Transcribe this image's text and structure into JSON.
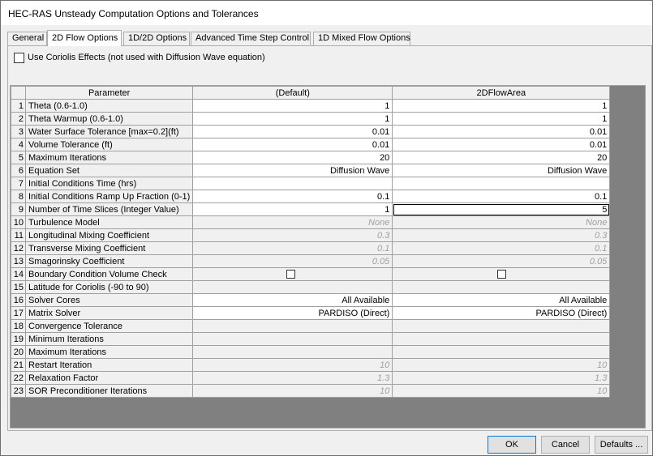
{
  "window": {
    "title": "HEC-RAS Unsteady Computation Options and Tolerances"
  },
  "tabs": [
    {
      "label": "General"
    },
    {
      "label": "2D Flow Options"
    },
    {
      "label": "1D/2D Options"
    },
    {
      "label": "Advanced Time Step Control"
    },
    {
      "label": "1D Mixed Flow Options"
    }
  ],
  "coriolis": {
    "label": "Use Coriolis Effects (not used with Diffusion Wave equation)",
    "checked": false
  },
  "grid": {
    "headers": {
      "parameter": "Parameter",
      "default": "(Default)",
      "area": "2DFlowArea"
    },
    "rows": [
      {
        "n": "1",
        "param": "Theta  (0.6-1.0)",
        "def": "1",
        "area": "1"
      },
      {
        "n": "2",
        "param": "Theta Warmup  (0.6-1.0)",
        "def": "1",
        "area": "1"
      },
      {
        "n": "3",
        "param": "Water Surface Tolerance [max=0.2](ft)",
        "def": "0.01",
        "area": "0.01"
      },
      {
        "n": "4",
        "param": "Volume Tolerance (ft)",
        "def": "0.01",
        "area": "0.01"
      },
      {
        "n": "5",
        "param": "Maximum Iterations",
        "def": "20",
        "area": "20"
      },
      {
        "n": "6",
        "param": "Equation Set",
        "def": "Diffusion Wave",
        "area": "Diffusion Wave"
      },
      {
        "n": "7",
        "param": "Initial Conditions Time (hrs)",
        "def": "",
        "area": ""
      },
      {
        "n": "8",
        "param": "Initial Conditions Ramp Up Fraction (0-1)",
        "def": "0.1",
        "area": "0.1"
      },
      {
        "n": "9",
        "param": "Number of Time Slices (Integer Value)",
        "def": "1",
        "area": "5"
      },
      {
        "n": "10",
        "param": "Turbulence Model",
        "def": "None",
        "area": "None"
      },
      {
        "n": "11",
        "param": "Longitudinal Mixing Coefficient",
        "def": "0.3",
        "area": "0.3"
      },
      {
        "n": "12",
        "param": "Transverse Mixing Coefficient",
        "def": "0.1",
        "area": "0.1"
      },
      {
        "n": "13",
        "param": "Smagorinsky Coefficient",
        "def": "0.05",
        "area": "0.05"
      },
      {
        "n": "14",
        "param": "Boundary Condition Volume Check",
        "def": "",
        "area": ""
      },
      {
        "n": "15",
        "param": "Latitude for Coriolis (-90 to 90)",
        "def": "",
        "area": ""
      },
      {
        "n": "16",
        "param": "Solver Cores",
        "def": "All Available",
        "area": "All Available"
      },
      {
        "n": "17",
        "param": "Matrix Solver",
        "def": "PARDISO (Direct)",
        "area": "PARDISO (Direct)"
      },
      {
        "n": "18",
        "param": "Convergence Tolerance",
        "def": "",
        "area": ""
      },
      {
        "n": "19",
        "param": "Minimum Iterations",
        "def": "",
        "area": ""
      },
      {
        "n": "20",
        "param": "Maximum Iterations",
        "def": "",
        "area": ""
      },
      {
        "n": "21",
        "param": "Restart Iteration",
        "def": "10",
        "area": "10"
      },
      {
        "n": "22",
        "param": "Relaxation Factor",
        "def": "1.3",
        "area": "1.3"
      },
      {
        "n": "23",
        "param": "SOR Preconditioner Iterations",
        "def": "10",
        "area": "10"
      }
    ]
  },
  "buttons": {
    "ok": "OK",
    "cancel": "Cancel",
    "defaults": "Defaults ..."
  }
}
